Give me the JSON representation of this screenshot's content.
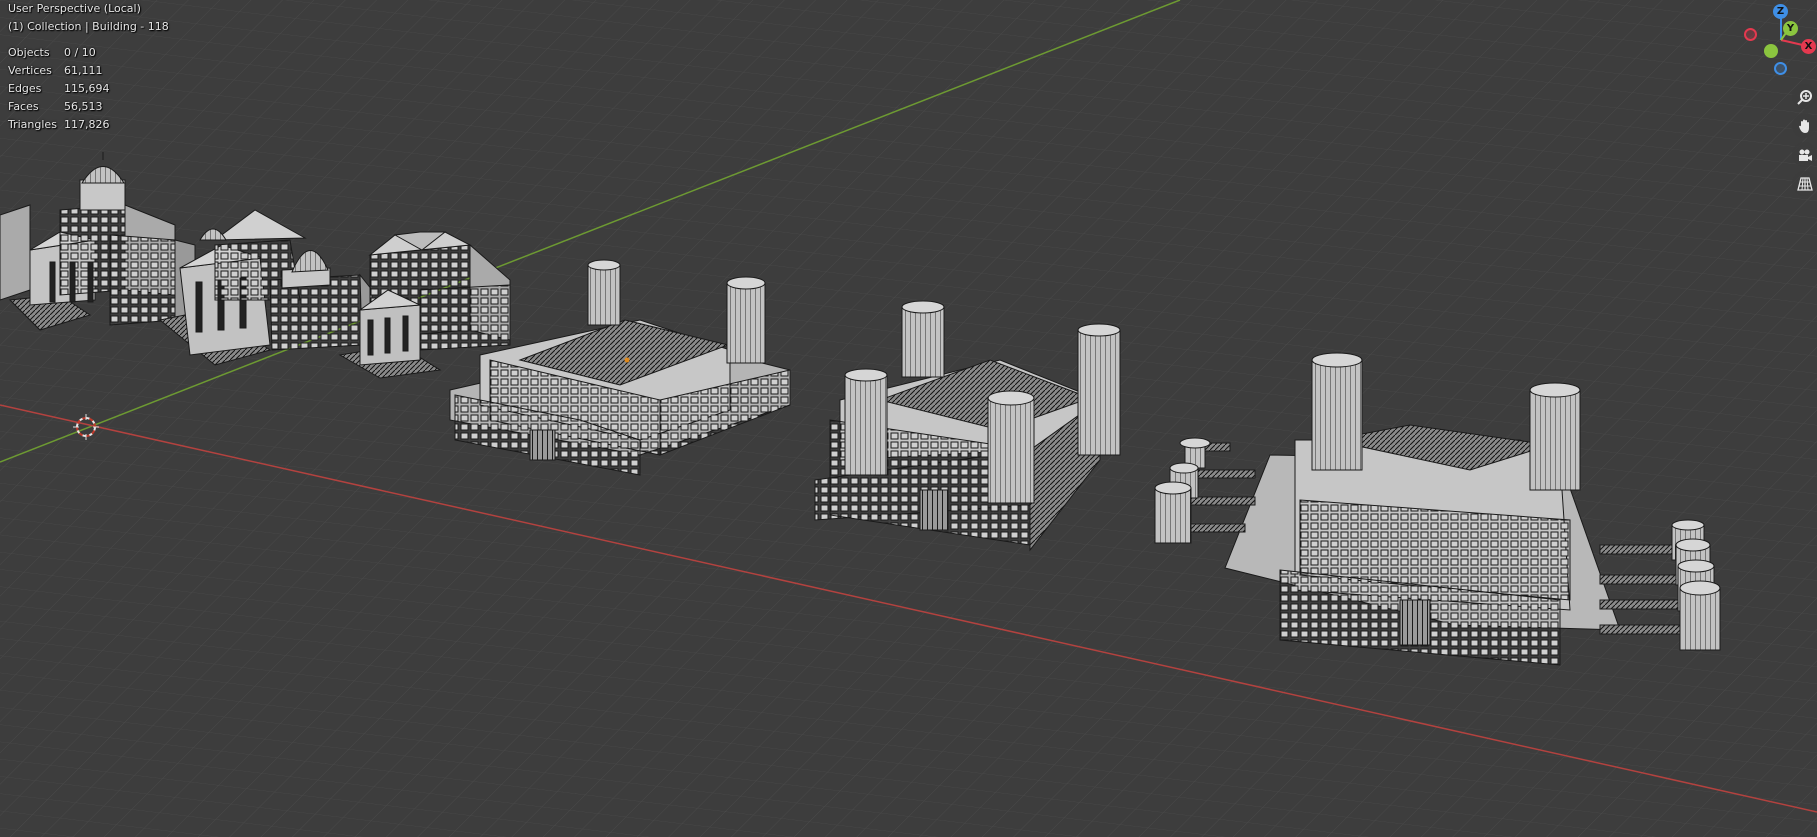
{
  "viewport": {
    "view_name": "User Perspective (Local)",
    "context": "(1) Collection | Building - 118"
  },
  "stats": [
    {
      "label": "Objects",
      "value": "0 / 10"
    },
    {
      "label": "Vertices",
      "value": "61,111"
    },
    {
      "label": "Edges",
      "value": "115,694"
    },
    {
      "label": "Faces",
      "value": "56,513"
    },
    {
      "label": "Triangles",
      "value": "117,826"
    }
  ],
  "gizmo": {
    "axes": [
      {
        "axis": "x",
        "label": "X",
        "color": "#e4394f"
      },
      {
        "axis": "y",
        "label": "Y",
        "color": "#8bc53f"
      },
      {
        "axis": "z",
        "label": "Z",
        "color": "#3f8fe6"
      }
    ]
  },
  "nav_buttons": [
    {
      "icon": "zoom-icon"
    },
    {
      "icon": "hand-pan-icon"
    },
    {
      "icon": "camera-icon"
    },
    {
      "icon": "grid-perspective-icon"
    }
  ],
  "colors": {
    "background": "#3d3d3d",
    "grid": "#4a4a4a",
    "x_axis": "#b3423f",
    "y_axis": "#6d9a32",
    "model_face": "#bdbdbd",
    "model_wire": "#1a1a1a"
  }
}
